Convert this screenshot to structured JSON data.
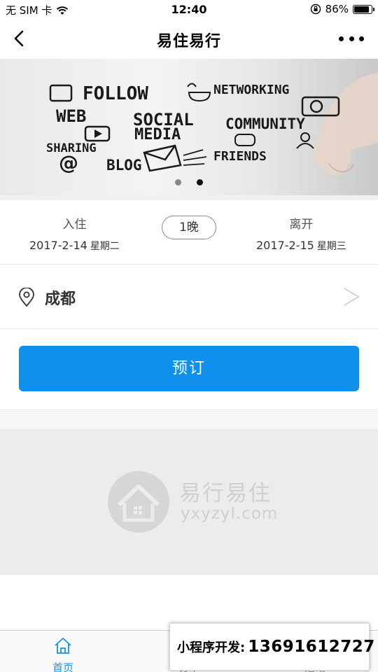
{
  "status_bar": {
    "carrier": "无 SIM 卡",
    "time": "12:40",
    "battery_percent": "86%",
    "battery_level": 0.86,
    "icons": [
      "wifi-icon",
      "orientation-lock-icon",
      "battery-icon"
    ]
  },
  "nav": {
    "title": "易住易行",
    "back_icon": "chevron-left-icon",
    "more_icon": "more-dots-icon"
  },
  "banner": {
    "words": [
      "FOLLOW",
      "NETWORKING",
      "WEB",
      "SOCIAL",
      "MEDIA",
      "COMMUNITY",
      "SHARING",
      "BLOG",
      "FRIENDS"
    ],
    "slide_count": 2,
    "active_slide": 2
  },
  "booking": {
    "checkin_label": "入住",
    "checkin_date": "2017-2-14",
    "checkin_weekday": "星期二",
    "nights": "1晚",
    "checkout_label": "离开",
    "checkout_date": "2017-2-15",
    "checkout_weekday": "星期三"
  },
  "city": {
    "name": "成都",
    "pin_icon": "location-pin-icon",
    "arrow_icon": "chevron-right-icon"
  },
  "book_button": "预订",
  "watermark": {
    "cn": "易行易住",
    "en": "yxyzyl.com"
  },
  "tabs": [
    {
      "label": "首页",
      "icon": "home-icon",
      "active": true
    },
    {
      "label": "订单",
      "icon": "order-icon",
      "active": false
    },
    {
      "label": "活动",
      "icon": "activity-icon",
      "active": false
    }
  ],
  "overlay": {
    "prefix": "小程序开发:",
    "phone": "13691612727"
  },
  "colors": {
    "primary": "#0e90ec",
    "tab_active": "#1b8fe3"
  }
}
